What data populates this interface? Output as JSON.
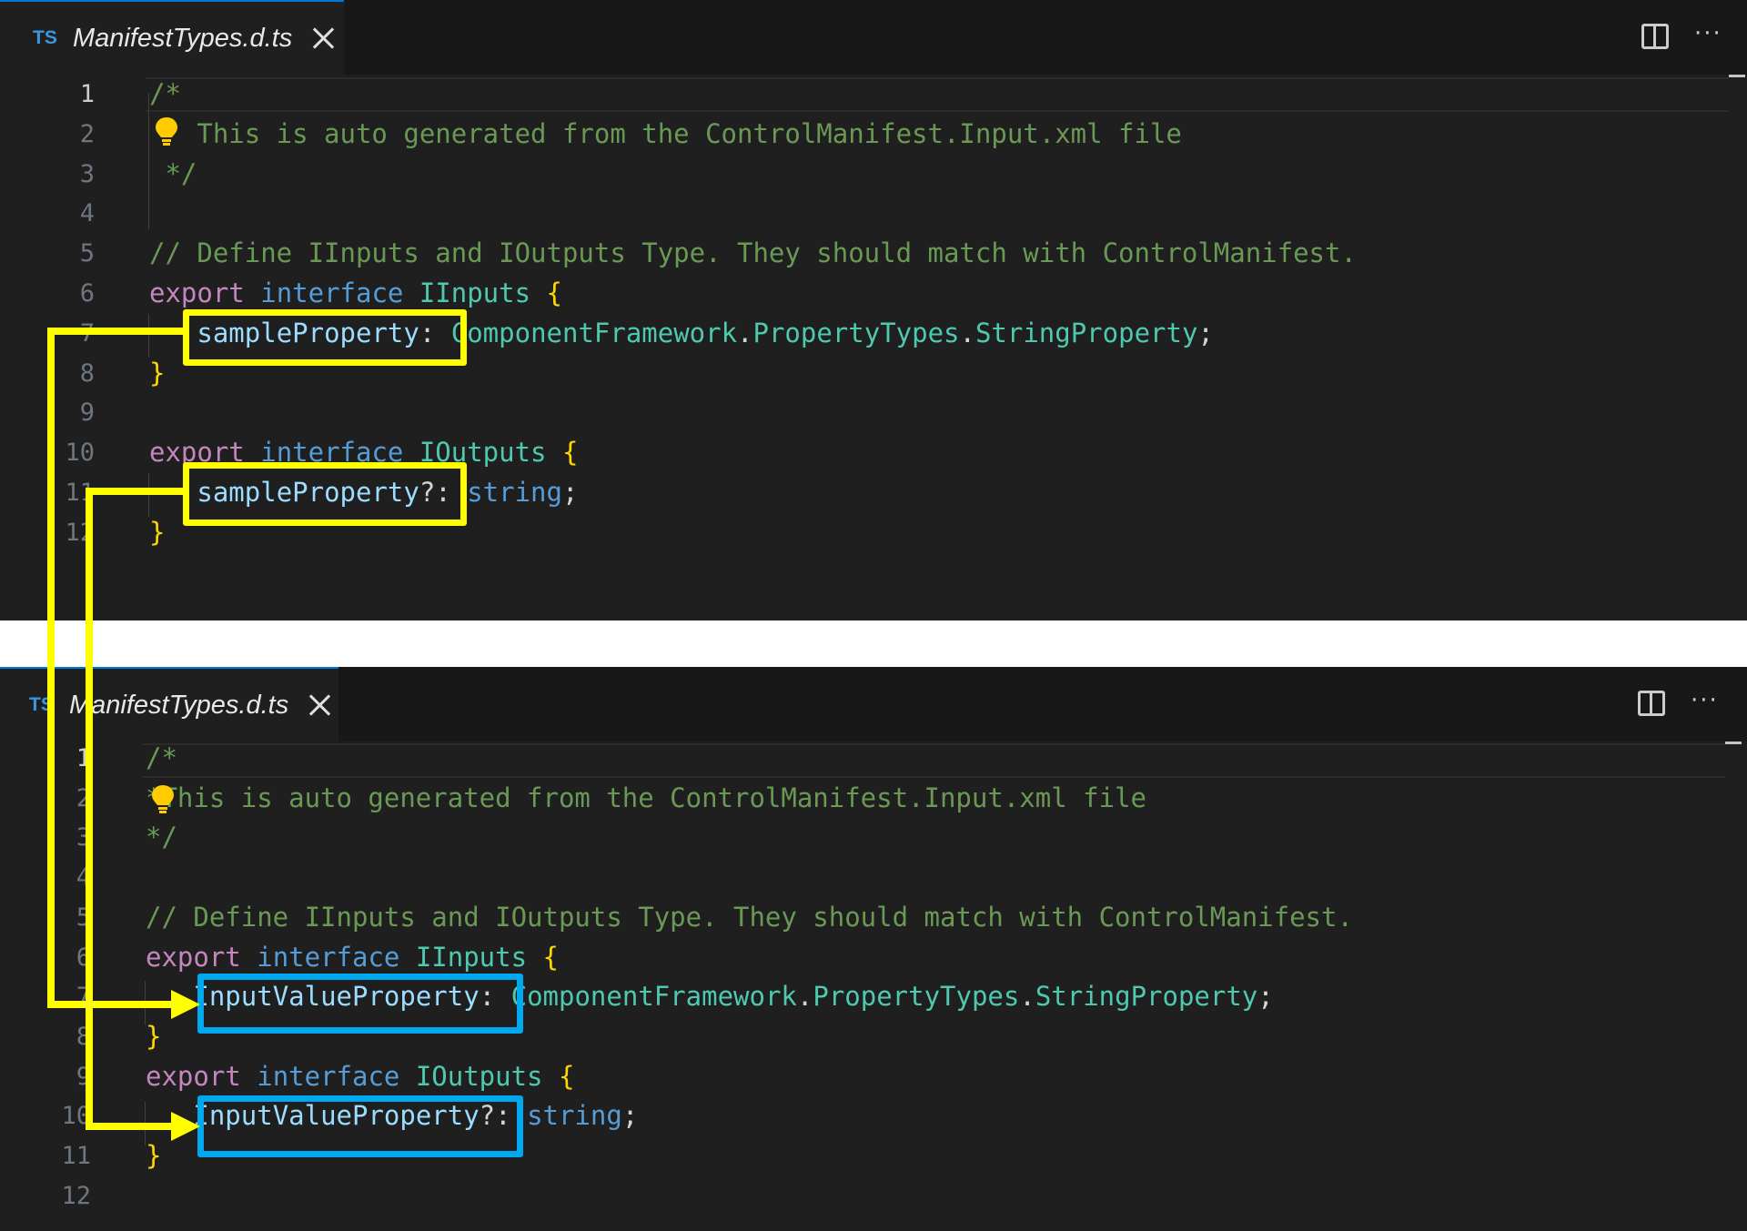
{
  "top_editor": {
    "tab": {
      "lang_badge": "TS",
      "filename": "ManifestTypes.d.ts"
    },
    "lines": [
      {
        "n": "1",
        "comment": "/*"
      },
      {
        "n": "2",
        "comment": " This is auto generated from the ControlManifest.Input.xml file"
      },
      {
        "n": "3",
        "comment": " */"
      },
      {
        "n": "4"
      },
      {
        "n": "5",
        "comment": "// Define IInputs and IOutputs Type. They should match with ControlManifest."
      },
      {
        "n": "6",
        "kw": "export",
        "key": "interface",
        "type": "IInputs",
        "brace": "{"
      },
      {
        "n": "7",
        "prop": "sampleProperty",
        "punct": ":",
        "type": "ComponentFramework",
        "dot1": ".",
        "type2": "PropertyTypes",
        "dot2": ".",
        "type3": "StringProperty",
        "end": ";"
      },
      {
        "n": "8",
        "brace": "}"
      },
      {
        "n": "9"
      },
      {
        "n": "10",
        "kw": "export",
        "key": "interface",
        "type": "IOutputs",
        "brace": "{"
      },
      {
        "n": "11",
        "prop": "sampleProperty",
        "punct": "?:",
        "key": "string",
        "end": ";"
      },
      {
        "n": "12",
        "brace": "}"
      }
    ]
  },
  "bottom_editor": {
    "tab": {
      "lang_badge": "TS",
      "filename": "ManifestTypes.d.ts"
    },
    "lines": [
      {
        "n": "1",
        "comment": "/*"
      },
      {
        "n": "2",
        "comment": "*This is auto generated from the ControlManifest.Input.xml file"
      },
      {
        "n": "3",
        "comment": "*/"
      },
      {
        "n": "4"
      },
      {
        "n": "5",
        "comment": "// Define IInputs and IOutputs Type. They should match with ControlManifest."
      },
      {
        "n": "6",
        "kw": "export",
        "key": "interface",
        "type": "IInputs",
        "brace": "{"
      },
      {
        "n": "7",
        "prop": "InputValueProperty",
        "punct": ":",
        "type": "ComponentFramework",
        "dot1": ".",
        "type2": "PropertyTypes",
        "dot2": ".",
        "type3": "StringProperty",
        "end": ";"
      },
      {
        "n": "8",
        "brace": "}"
      },
      {
        "n": "9",
        "kw": "export",
        "key": "interface",
        "type": "IOutputs",
        "brace": "{"
      },
      {
        "n": "10",
        "prop": "InputValueProperty",
        "punct": "?:",
        "key": "string",
        "end": ";"
      },
      {
        "n": "11",
        "brace": "}"
      },
      {
        "n": "12"
      }
    ]
  },
  "colors": {
    "highlight_old": "#ffff00",
    "highlight_new": "#00a8f0"
  },
  "icons": [
    "split-editor-icon",
    "more-actions-icon",
    "close-icon",
    "lightbulb-icon",
    "arrow-icon"
  ]
}
